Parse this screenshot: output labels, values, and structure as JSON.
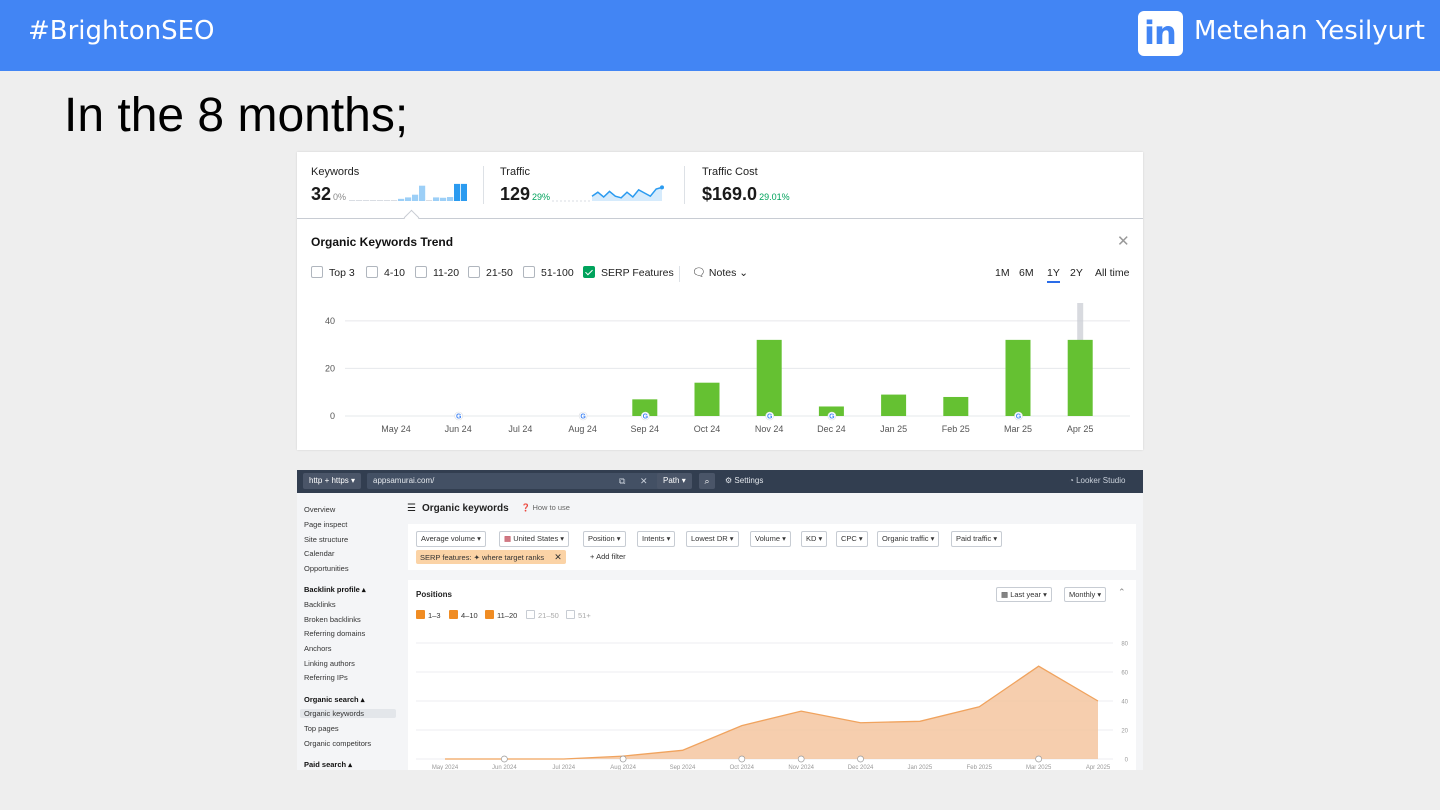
{
  "slide": {
    "hashtag": "#BrightonSEO",
    "linkedin_logo": "in",
    "author": "Metehan Yesilyurt",
    "title": "In the 8 months;"
  },
  "semrush": {
    "metrics": [
      {
        "label": "Keywords",
        "value": "32",
        "change": "0%"
      },
      {
        "label": "Traffic",
        "value": "129",
        "change": "29%"
      },
      {
        "label": "Traffic Cost",
        "value": "$169.0",
        "change": "29.01%"
      }
    ],
    "keywords_spark": [
      0.02,
      0.02,
      0.02,
      0.02,
      0.02,
      0.02,
      0.05,
      0.12,
      0.2,
      0.35,
      0.85,
      0.05,
      0.2,
      0.18,
      0.22,
      0.95,
      0.95
    ],
    "traffic_spark": [
      0.3,
      0.55,
      0.25,
      0.6,
      0.3,
      0.2,
      0.55,
      0.25,
      0.7,
      0.5,
      0.3,
      0.75,
      0.85
    ],
    "trend_title": "Organic Keywords Trend",
    "filters": [
      "Top 3",
      "4-10",
      "11-20",
      "21-50",
      "51-100",
      "SERP Features"
    ],
    "notes_label": "Notes",
    "ranges": [
      "1M",
      "6M",
      "1Y",
      "2Y",
      "All time"
    ],
    "active_range": "1Y"
  },
  "ahrefs": {
    "protocol": "http + https",
    "url": "appsamurai.com/",
    "path_label": "Path",
    "settings_label": "Settings",
    "looker_label": "Looker Studio",
    "sidebar": [
      {
        "label": "Overview"
      },
      {
        "label": "Page inspect"
      },
      {
        "label": "Site structure"
      },
      {
        "label": "Calendar"
      },
      {
        "label": "Opportunities"
      },
      {
        "label": "Backlink profile ▴",
        "head": true
      },
      {
        "label": "Backlinks"
      },
      {
        "label": "Broken backlinks"
      },
      {
        "label": "Referring domains"
      },
      {
        "label": "Anchors"
      },
      {
        "label": "Linking authors"
      },
      {
        "label": "Referring IPs"
      },
      {
        "label": "Organic search ▴",
        "head": true
      },
      {
        "label": "Organic keywords",
        "active": true
      },
      {
        "label": "Top pages"
      },
      {
        "label": "Organic competitors"
      },
      {
        "label": "Paid search ▴",
        "head": true
      }
    ],
    "page_title": "Organic keywords",
    "how_to_use": "How to use",
    "filter_chips": [
      "Average volume ▾",
      "United States ▾",
      "Position ▾",
      "Intents ▾",
      "Lowest DR ▾",
      "Volume ▾",
      "KD ▾",
      "CPC ▾",
      "Organic traffic ▾",
      "Paid traffic ▾"
    ],
    "serp_chip": "SERP features: ✦ where target ranks",
    "add_filter": "Add filter",
    "positions_title": "Positions",
    "period_select": "Last year ▾",
    "interval_select": "Monthly ▾",
    "legend": [
      {
        "label": "1–3",
        "checked": true
      },
      {
        "label": "4–10",
        "checked": true
      },
      {
        "label": "11–20",
        "checked": true
      },
      {
        "label": "21–50",
        "checked": false
      },
      {
        "label": "51+",
        "checked": false
      }
    ]
  },
  "chart_data": [
    {
      "type": "bar",
      "title": "Organic Keywords Trend",
      "categories": [
        "May 24",
        "Jun 24",
        "Jul 24",
        "Aug 24",
        "Sep 24",
        "Oct 24",
        "Nov 24",
        "Dec 24",
        "Jan 25",
        "Feb 25",
        "Mar 25",
        "Apr 25"
      ],
      "series": [
        {
          "name": "SERP Features",
          "values": [
            0,
            0,
            0,
            0,
            7,
            14,
            32,
            4,
            9,
            8,
            32,
            32
          ]
        }
      ],
      "yticks": [
        0,
        20,
        40
      ],
      "ylim": [
        0,
        48
      ],
      "google_markers": [
        "Jun 24",
        "Aug 24",
        "Sep 24",
        "Nov 24",
        "Dec 24",
        "Mar 25"
      ],
      "color": "#65c132",
      "grid": true
    },
    {
      "type": "area",
      "title": "Positions",
      "categories": [
        "May 2024",
        "Jun 2024",
        "Jul 2024",
        "Aug 2024",
        "Sep 2024",
        "Oct 2024",
        "Nov 2024",
        "Dec 2024",
        "Jan 2025",
        "Feb 2025",
        "Mar 2025",
        "Apr 2025"
      ],
      "series": [
        {
          "name": "11–20",
          "values": [
            0,
            0,
            0,
            2,
            6,
            23,
            33,
            25,
            26,
            36,
            64,
            40
          ]
        }
      ],
      "yticks": [
        0,
        20,
        40,
        60,
        80
      ],
      "ylim": [
        0,
        80
      ],
      "markers": [
        "Jun 2024",
        "Aug 2024",
        "Oct 2024",
        "Nov 2024",
        "Dec 2024",
        "Mar 2025"
      ],
      "color": "#f0a35e",
      "grid": true
    }
  ]
}
